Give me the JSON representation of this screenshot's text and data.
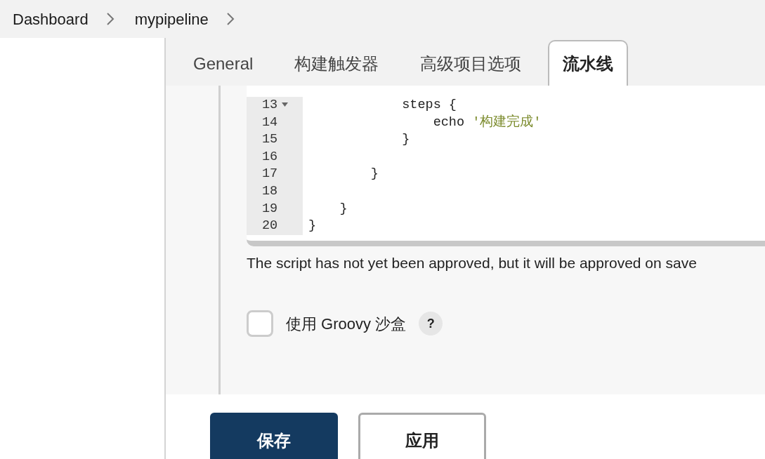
{
  "breadcrumb": [
    {
      "label": "Dashboard"
    },
    {
      "label": "mypipeline"
    }
  ],
  "tabs": [
    {
      "label": "General",
      "selected": false
    },
    {
      "label": "构建触发器",
      "selected": false
    },
    {
      "label": "高级项目选项",
      "selected": false
    },
    {
      "label": "流水线",
      "selected": true
    }
  ],
  "editor": {
    "lines": [
      {
        "number": "13",
        "foldable": true,
        "tokens": [
          {
            "kind": "plain",
            "text": "            steps {"
          }
        ]
      },
      {
        "number": "14",
        "foldable": false,
        "tokens": [
          {
            "kind": "plain",
            "text": "                echo "
          },
          {
            "kind": "string",
            "text": "'构建完成'"
          }
        ]
      },
      {
        "number": "15",
        "foldable": false,
        "tokens": [
          {
            "kind": "plain",
            "text": "            }"
          }
        ]
      },
      {
        "number": "16",
        "foldable": false
      },
      {
        "number": "17",
        "foldable": false,
        "tokens": [
          {
            "kind": "plain",
            "text": "        }"
          }
        ]
      },
      {
        "number": "18",
        "foldable": false
      },
      {
        "number": "19",
        "foldable": false,
        "tokens": [
          {
            "kind": "plain",
            "text": "    }"
          }
        ]
      },
      {
        "number": "20",
        "foldable": false,
        "tokens": [
          {
            "kind": "plain",
            "text": "}"
          }
        ]
      }
    ]
  },
  "approval_note": "The script has not yet been approved, but it will be approved on save",
  "sandbox": {
    "label": "使用 Groovy 沙盒",
    "checked": false,
    "help": "?"
  },
  "buttons": [
    {
      "label": "保存",
      "kind": "primary"
    },
    {
      "label": "应用",
      "kind": "secondary"
    }
  ]
}
